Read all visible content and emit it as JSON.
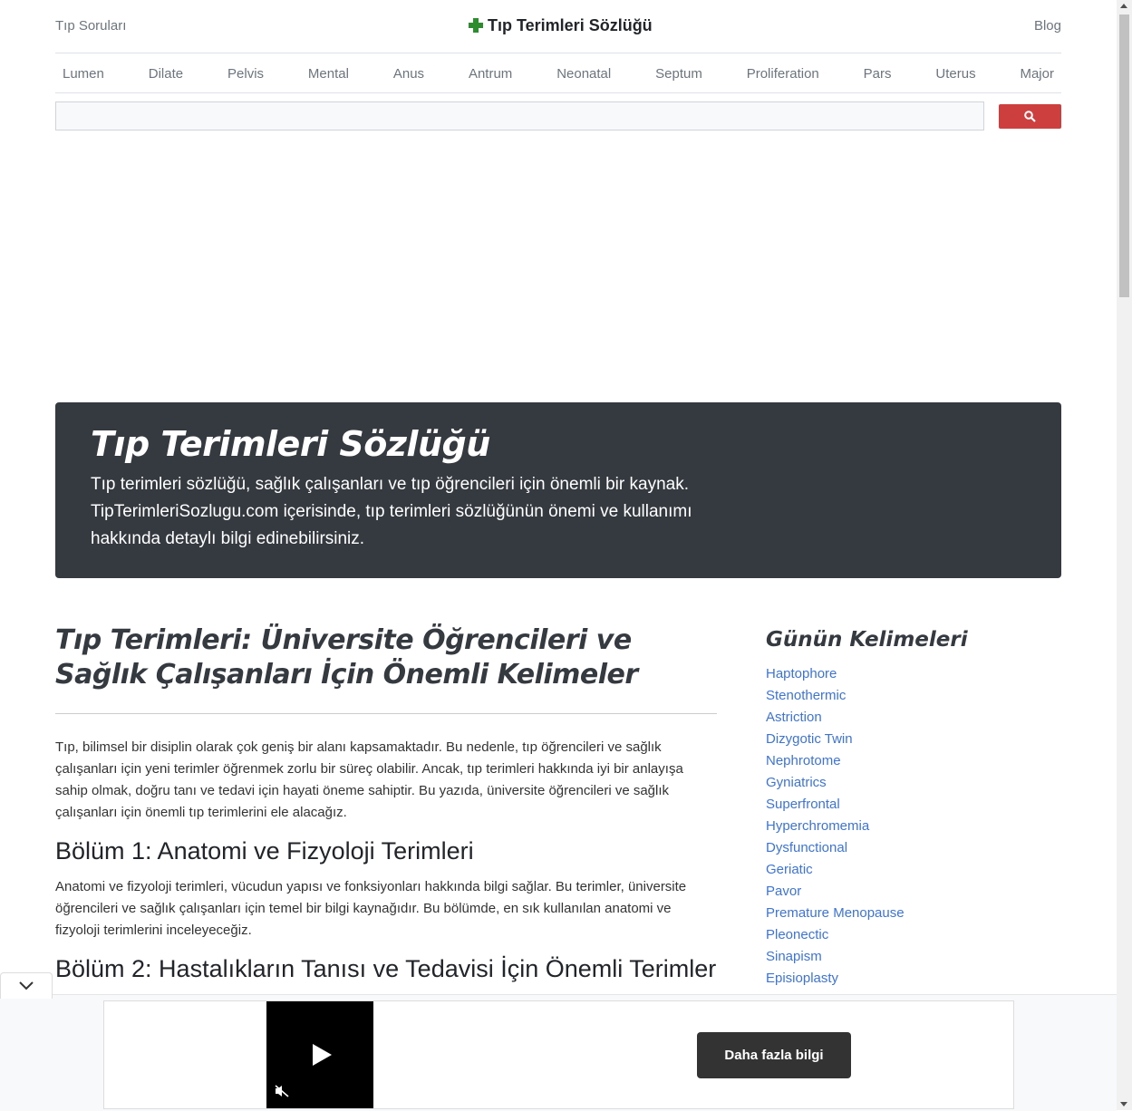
{
  "header": {
    "left_link": "Tıp Soruları",
    "title": "Tıp Terimleri Sözlüğü",
    "right_link": "Blog"
  },
  "nav": [
    "Lumen",
    "Dilate",
    "Pelvis",
    "Mental",
    "Anus",
    "Antrum",
    "Neonatal",
    "Septum",
    "Proliferation",
    "Pars",
    "Uterus",
    "Major"
  ],
  "search": {
    "placeholder": ""
  },
  "jumbotron": {
    "title": "Tıp Terimleri Sözlüğü",
    "text": "Tıp terimleri sözlüğü, sağlık çalışanları ve tıp öğrencileri için önemli bir kaynak. TipTerimleriSozlugu.com içerisinde, tıp terimleri sözlüğünün önemi ve kullanımı hakkında detaylı bilgi edinebilirsiniz."
  },
  "article": {
    "title": "Tıp Terimleri: Üniversite Öğrencileri ve Sağlık Çalışanları İçin Önemli Kelimeler",
    "intro": "Tıp, bilimsel bir disiplin olarak çok geniş bir alanı kapsamaktadır. Bu nedenle, tıp öğrencileri ve sağlık çalışanları için yeni terimler öğrenmek zorlu bir süreç olabilir. Ancak, tıp terimleri hakkında iyi bir anlayışa sahip olmak, doğru tanı ve tedavi için hayati öneme sahiptir. Bu yazıda, üniversite öğrencileri ve sağlık çalışanları için önemli tıp terimlerini ele alacağız.",
    "section1_title": "Bölüm 1: Anatomi ve Fizyoloji Terimleri",
    "section1_text": "Anatomi ve fizyoloji terimleri, vücudun yapısı ve fonksiyonları hakkında bilgi sağlar. Bu terimler, üniversite öğrencileri ve sağlık çalışanları için temel bir bilgi kaynağıdır. Bu bölümde, en sık kullanılan anatomi ve fizyoloji terimlerini inceleyeceğiz.",
    "section2_title": "Bölüm 2: Hastalıkların Tanısı ve Tedavisi İçin Önemli Terimler"
  },
  "sidebar": {
    "title": "Günün Kelimeleri",
    "words": [
      "Haptophore",
      "Stenothermic",
      "Astriction",
      "Dizygotic Twin",
      "Nephrotome",
      "Gyniatrics",
      "Superfrontal",
      "Hyperchromemia",
      "Dysfunctional",
      "Geriatic",
      "Pavor",
      "Premature Menopause",
      "Pleonectic",
      "Sinapism",
      "Episioplasty"
    ]
  },
  "ad": {
    "button_label": "Daha fazla bilgi"
  },
  "colors": {
    "accent": "#3d74d6",
    "search_button": "#cd3e3e",
    "jumbotron_bg": "#343a40",
    "plus_icon": "#2e8b2e"
  }
}
